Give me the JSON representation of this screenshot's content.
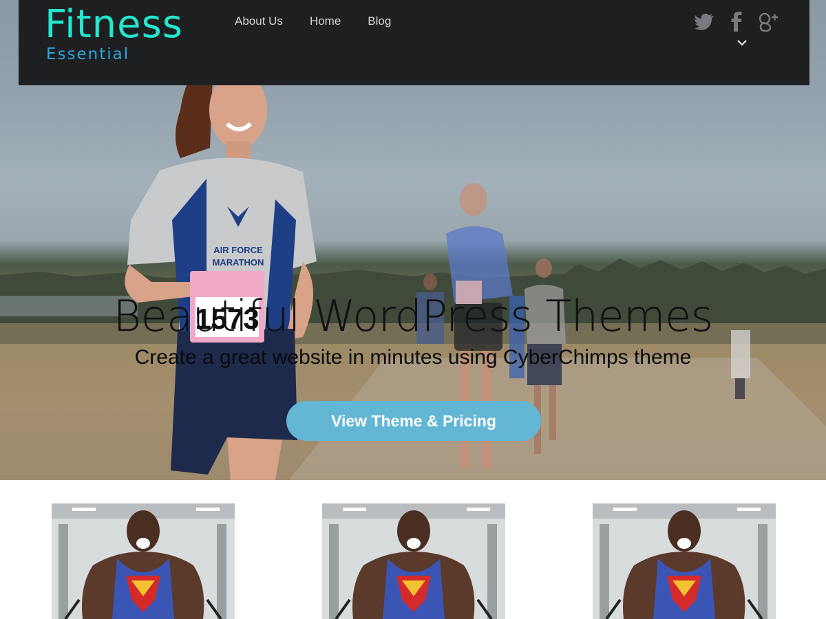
{
  "brand": {
    "name": "Fitness",
    "tagline": "Essential"
  },
  "nav": {
    "items": [
      "About Us",
      "Home",
      "Blog"
    ]
  },
  "social": {
    "icons": [
      "twitter-icon",
      "facebook-icon",
      "google-plus-icon"
    ]
  },
  "hero": {
    "title": "Beautiful WordPress Themes",
    "subtitle": "Create a great website in minutes using CyberChimps theme",
    "cta_label": "View Theme & Pricing",
    "bib_number": "1573",
    "shirt_text_1": "AIR FORCE",
    "shirt_text_2": "MARATHON"
  },
  "colors": {
    "header_bg": "#1e1f21",
    "logo_primary": "#21e8cf",
    "logo_secondary": "#2aa7dd",
    "cta_bg": "#63b7d5"
  },
  "cards": [
    {
      "image": "athlete-superman-tank-photo"
    },
    {
      "image": "athlete-superman-tank-photo"
    },
    {
      "image": "athlete-superman-tank-photo"
    }
  ]
}
